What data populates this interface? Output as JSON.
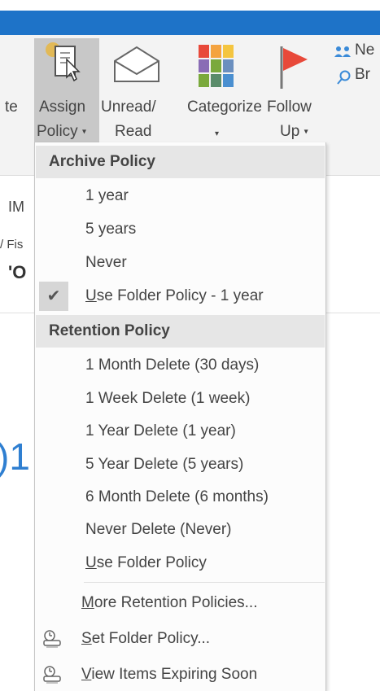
{
  "ribbon": {
    "left_cut_label": "te",
    "assign_policy": {
      "line1": "Assign",
      "line2": "Policy",
      "caret": "▾"
    },
    "unread_read": {
      "line1": "Unread/",
      "line2": "Read"
    },
    "categorize": {
      "line1": "Categorize",
      "caret": "▾"
    },
    "follow_up": {
      "line1": "Follow",
      "line2": "Up",
      "caret": "▾"
    },
    "new_group_cut": "Ne",
    "browse_cut": "Br",
    "colors": {
      "accent_blue": "#1e73c8",
      "flag_red": "#e8493a"
    }
  },
  "background_content": {
    "im_text": "IM",
    "fis_text": "/ Fis",
    "o_text": "'O",
    "big_number": ")1"
  },
  "menu": {
    "archive_header": "Archive Policy",
    "archive_items": [
      "1 year",
      "5 years",
      "Never"
    ],
    "archive_checked": {
      "mnemonic": "U",
      "rest": "se Folder Policy - 1 year",
      "checked": true
    },
    "retention_header": "Retention Policy",
    "retention_items": [
      "1 Month Delete (30 days)",
      "1 Week Delete (1 week)",
      "1 Year Delete (1 year)",
      "5 Year Delete (5 years)",
      "6 Month Delete (6 months)",
      "Never Delete (Never)"
    ],
    "retention_folder": {
      "mnemonic": "U",
      "rest": "se Folder Policy"
    },
    "more_policies": {
      "mnemonic": "M",
      "rest": "ore Retention Policies..."
    },
    "set_folder_policy": {
      "mnemonic": "S",
      "rest": "et Folder Policy..."
    },
    "view_expiring": {
      "mnemonic": "V",
      "rest": "iew Items Expiring Soon"
    }
  }
}
